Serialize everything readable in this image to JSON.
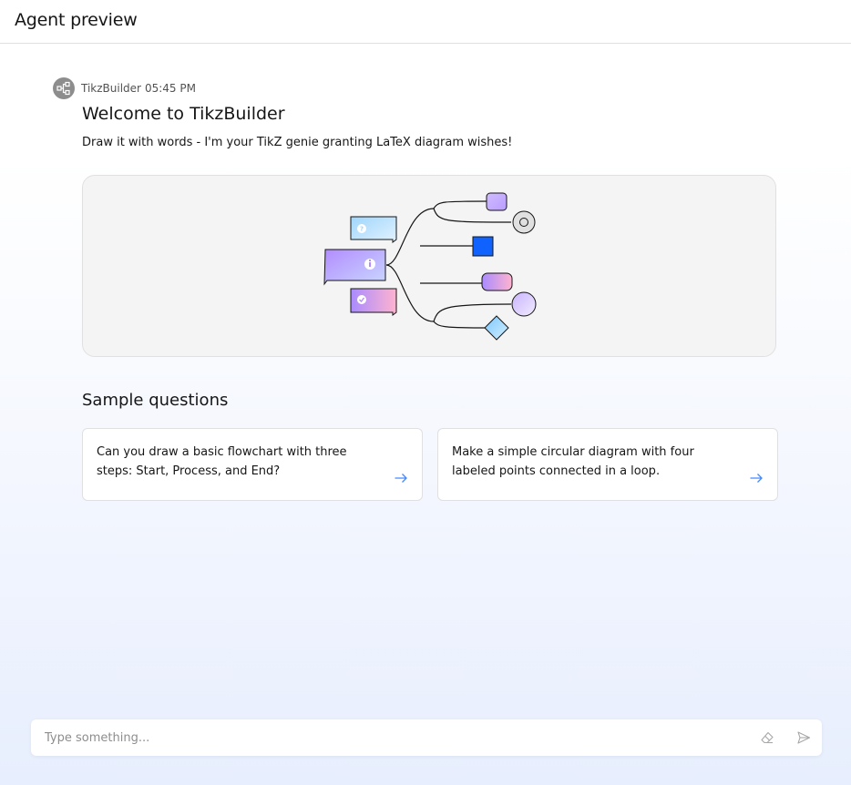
{
  "header": {
    "title": "Agent preview"
  },
  "message": {
    "agent_name": "TikzBuilder",
    "time": "05:45 PM",
    "avatar_icon": "flow-diagram-icon",
    "title": "Welcome to TikzBuilder",
    "subtitle": "Draw it with words - I'm your TikZ genie granting LaTeX diagram wishes!"
  },
  "samples": {
    "title": "Sample questions",
    "items": [
      {
        "text": "Can you draw a basic flowchart with three steps: Start, Process, and End?",
        "icon": "arrow-right-icon"
      },
      {
        "text": "Make a simple circular diagram with four labeled points connected in a loop.",
        "icon": "arrow-right-icon"
      }
    ]
  },
  "input": {
    "placeholder": "Type something...",
    "clear_icon": "eraser-icon",
    "send_icon": "send-icon"
  },
  "colors": {
    "accent": "#0f62fe",
    "link_arrow": "#4589ff",
    "text": "#161616",
    "muted": "#525252",
    "placeholder": "#8d8d8d",
    "avatar": "#8d8d8d"
  }
}
